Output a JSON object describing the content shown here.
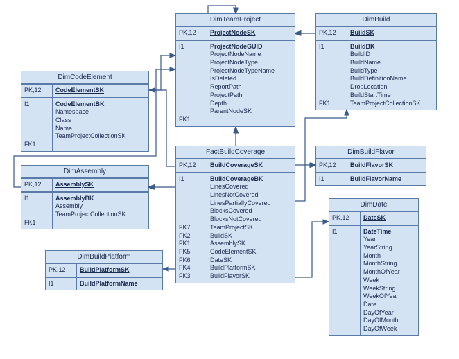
{
  "entities": {
    "dimTeamProject": {
      "title": "DimTeamProject",
      "pk_key": "PK,12",
      "pk_val": "ProjectNodeSK",
      "body_key_lines": [
        "I1",
        "",
        "",
        "",
        "",
        "",
        "",
        "",
        "",
        "FK1"
      ],
      "body_val_lines": [
        "ProjectNodeGUID",
        "ProjectNodeName",
        "ProjectNodeType",
        "ProjectNodeTypeName",
        "IsDeleted",
        "ReportPath",
        "ProjectPath",
        "Depth",
        "ParentNodeSK"
      ]
    },
    "dimBuild": {
      "title": "DimBuild",
      "pk_key": "PK,12",
      "pk_val": "BuildSK",
      "body_key_lines": [
        "I1",
        "",
        "",
        "",
        "",
        "",
        "",
        "",
        "FK1"
      ],
      "body_val_lines": [
        "BuildBK",
        "BuildID",
        "BuildName",
        "BuildType",
        "BuildDefinitionName",
        "DropLocation",
        "BuildStartTime",
        "TeamProjectCollectionSK"
      ]
    },
    "dimCodeElement": {
      "title": "DimCodeElement",
      "pk_key": "PK,12",
      "pk_val": "CodeElementSK",
      "body_key_lines": [
        "I1",
        "",
        "",
        "",
        "",
        "FK1"
      ],
      "body_val_lines": [
        "CodeElementBK",
        "Namespace",
        "Class",
        "Name",
        "TeamProjectCollectionSK"
      ]
    },
    "dimAssembly": {
      "title": "DimAssembly",
      "pk_key": "PK,12",
      "pk_val": "AssemblySK",
      "body_key_lines": [
        "I1",
        "",
        "",
        "FK1"
      ],
      "body_val_lines": [
        "AssemblyBK",
        "Assembly",
        "TeamProjectCollectionSK"
      ]
    },
    "dimBuildPlatform": {
      "title": "DimBuildPlatform",
      "pk_key": "PK,12",
      "pk_val": "BuildPlatformSK",
      "b_key": "I1",
      "b_val": "BuildPlatformName"
    },
    "dimBuildFlavor": {
      "title": "DimBuildFlavor",
      "pk_key": "PK,12",
      "pk_val": "BuildFlavorSK",
      "b_key": "I1",
      "b_val": "BuildFlavorName"
    },
    "dimDate": {
      "title": "DimDate",
      "pk_key": "PK,12",
      "pk_val": "DateSK",
      "body_key_lines": [
        "I1"
      ],
      "body_val_lines": [
        "DateTime",
        "Year",
        "YearString",
        "Month",
        "MonthString",
        "MonthOfYear",
        "Week",
        "WeekString",
        "WeekOfYear",
        "Date",
        "DayOfYear",
        "DayOfMonth",
        "DayOfWeek"
      ]
    },
    "factBuildCoverage": {
      "title": "FactBuildCoverage",
      "pk_key": "PK,12",
      "pk_val": "BuildCoverageSK",
      "body_key_lines": [
        "I1",
        "",
        "",
        "",
        "",
        "",
        "FK7",
        "FK2",
        "FK1",
        "FK5",
        "FK6",
        "FK4",
        "FK3"
      ],
      "body_val_lines": [
        "BuildCoverageBK",
        "LinesCovered",
        "LinesNotCovered",
        "LinesPartiallyCovered",
        "BlocksCovered",
        "BlocksNotCovered",
        "TeamProjectSK",
        "BuildSK",
        "AssemblySK",
        "CodeElementSK",
        "DateSK",
        "BuildPlatformSK",
        "BuildFlavorSK"
      ]
    }
  }
}
